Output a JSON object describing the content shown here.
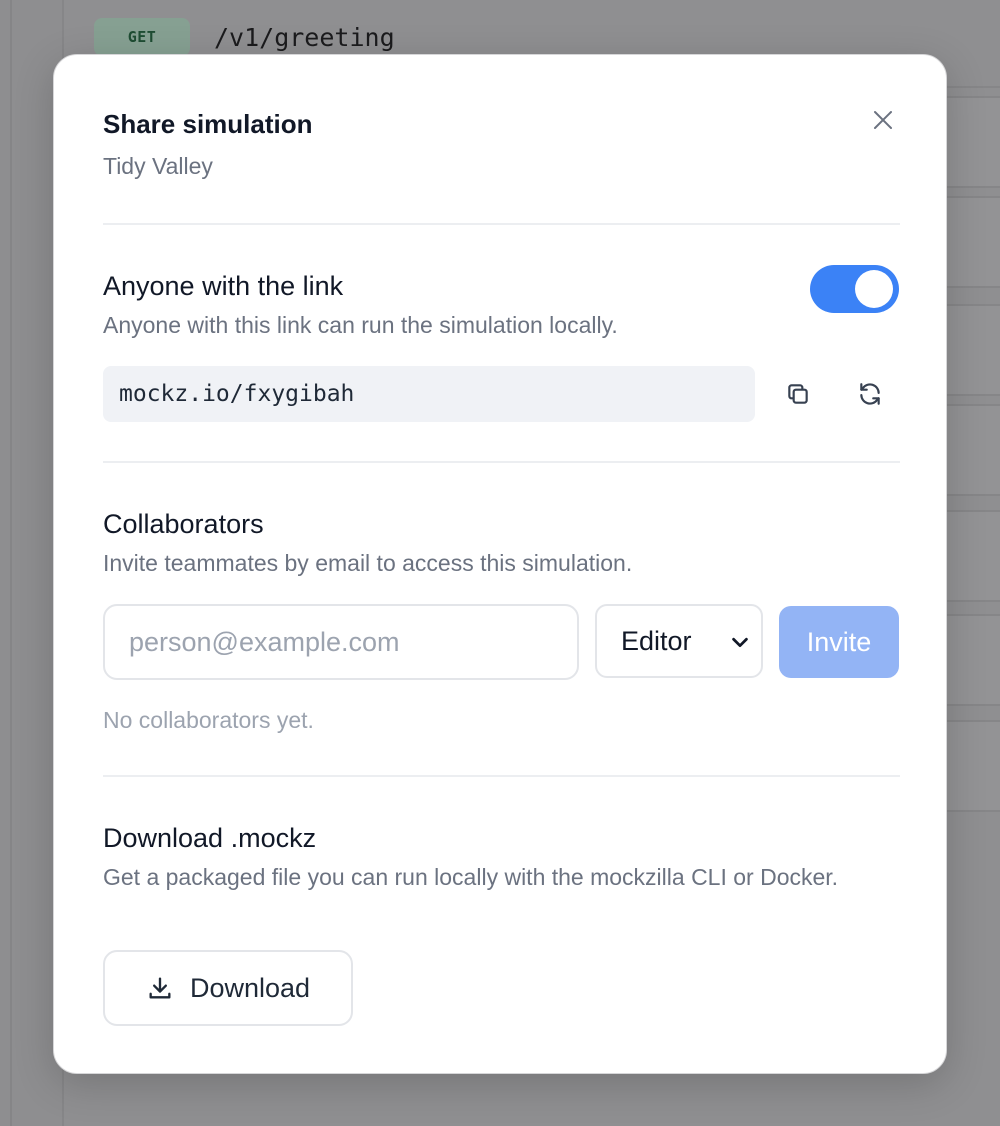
{
  "background": {
    "method": "GET",
    "path": "/v1/greeting"
  },
  "modal": {
    "title": "Share simulation",
    "subtitle": "Tidy Valley",
    "close_icon": "close-icon"
  },
  "link_section": {
    "title": "Anyone with the link",
    "description": "Anyone with this link can run the simulation locally.",
    "toggle_on": true,
    "link": "mockz.io/fxygibah",
    "copy_icon": "copy-icon",
    "regenerate_icon": "refresh-icon"
  },
  "collaborators": {
    "title": "Collaborators",
    "description": "Invite teammates by email to access this simulation.",
    "email_placeholder": "person@example.com",
    "email_value": "",
    "role_selected": "Editor",
    "invite_label": "Invite",
    "empty_text": "No collaborators yet."
  },
  "download": {
    "title": "Download .mockz",
    "description": "Get a packaged file you can run locally with the mockzilla CLI or Docker.",
    "button_label": "Download",
    "button_icon": "download-icon"
  },
  "colors": {
    "accent": "#3b82f6",
    "accent_disabled": "#93b4f5",
    "muted_text": "#6b7280",
    "overlay": "#8f8f91"
  }
}
